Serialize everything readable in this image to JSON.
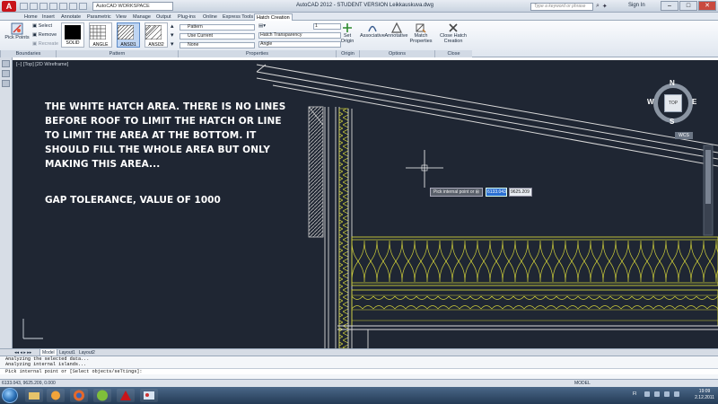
{
  "title_bar": {
    "app_logo": "A",
    "workspace": "AutoCAD WORKSPACE",
    "window_title": "AutoCAD 2012 - STUDENT VERSION     Leikkauskuva.dwg",
    "search_placeholder": "Type a keyword or phrase",
    "sign_in": "Sign In"
  },
  "ribbon_tabs": [
    "Home",
    "Insert",
    "Annotate",
    "Parametric",
    "View",
    "Manage",
    "Output",
    "Plug-ins",
    "Online",
    "Express Tools",
    "Hatch Creation"
  ],
  "active_tab": "Hatch Creation",
  "ribbon": {
    "boundaries": {
      "pick_points": "Pick Points",
      "select": "Select",
      "remove": "Remove",
      "recreate": "Recreate",
      "panel": "Boundaries"
    },
    "pattern": {
      "items": [
        "SOLID",
        "ANGLE",
        "ANSI31",
        "ANSI32"
      ],
      "selected": "ANSI31",
      "panel": "Pattern"
    },
    "properties": {
      "pattern_type": "Pattern",
      "color": "Use Current",
      "background": "None",
      "transparency": "Hatch Transparency",
      "transparency_value": "0",
      "angle": "Angle",
      "angle_value": "0",
      "scale_value": "1",
      "panel": "Properties"
    },
    "origin": {
      "set_origin": "Set Origin",
      "panel": "Origin"
    },
    "options": {
      "associative": "Associative",
      "annotative": "Annotative",
      "match_properties": "Match Properties",
      "panel": "Options"
    },
    "close": {
      "close_hatch": "Close Hatch Creation",
      "panel": "Close"
    }
  },
  "viewport": {
    "label": "[−] [Top] [2D Wireframe]",
    "annotation_lines": [
      "THE WHITE HATCH AREA. THERE IS NO LINES",
      "BEFORE ROOF TO LIMIT THE HATCH OR LINE",
      "TO LIMIT THE AREA AT THE BOTTOM. IT",
      "SHOULD FILL THE WHOLE AREA BUT ONLY",
      "MAKING THIS AREA..."
    ],
    "annotation_gap": "GAP TOLERANCE, VALUE OF 1000",
    "tooltip": "Pick internal point or",
    "input_x": "6133.043",
    "input_y": "9625.209",
    "viewcube": {
      "top": "TOP",
      "n": "N",
      "s": "S",
      "e": "E",
      "w": "W",
      "wcs": "WCS"
    }
  },
  "layout_tabs": [
    "Model",
    "Layout1",
    "Layout2"
  ],
  "active_layout": "Model",
  "command_history": [
    "Analyzing the selected data...",
    "Analyzing internal islands...",
    "Pick internal point or [Select objects/seTtings]:"
  ],
  "status_bar": {
    "coordinates": "6133.043, 9625.209, 0.000",
    "model": "MODEL"
  },
  "taskbar": {
    "lang": "FI",
    "time": "19:09",
    "date": "2.12.2011"
  }
}
